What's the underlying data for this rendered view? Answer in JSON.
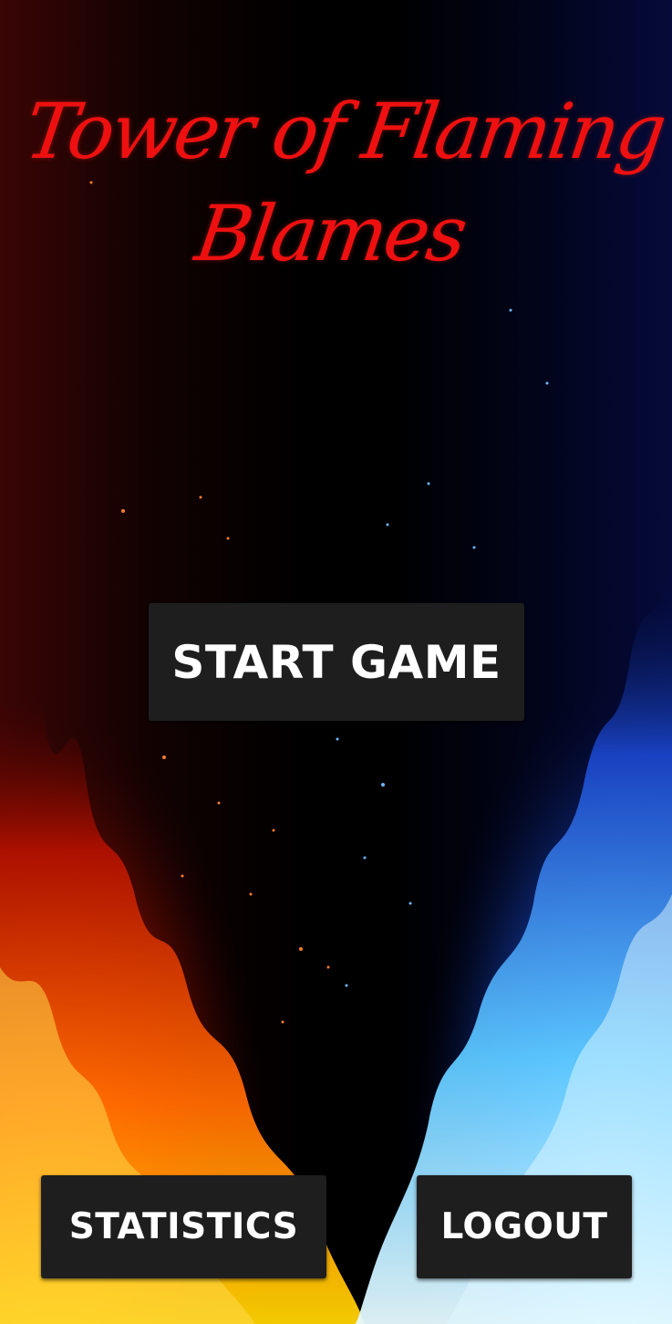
{
  "game": {
    "title_line1": "Tower of Flaming",
    "title_line2": "Blames"
  },
  "menu": {
    "start_label": "START GAME",
    "statistics_label": "STATISTICS",
    "logout_label": "LOGOUT"
  },
  "colors": {
    "title": "#ee1010",
    "button_bg": "#1e1e1e",
    "button_text": "#ffffff",
    "red_fire": "#ff5a00",
    "blue_fire": "#3aa0ff"
  }
}
